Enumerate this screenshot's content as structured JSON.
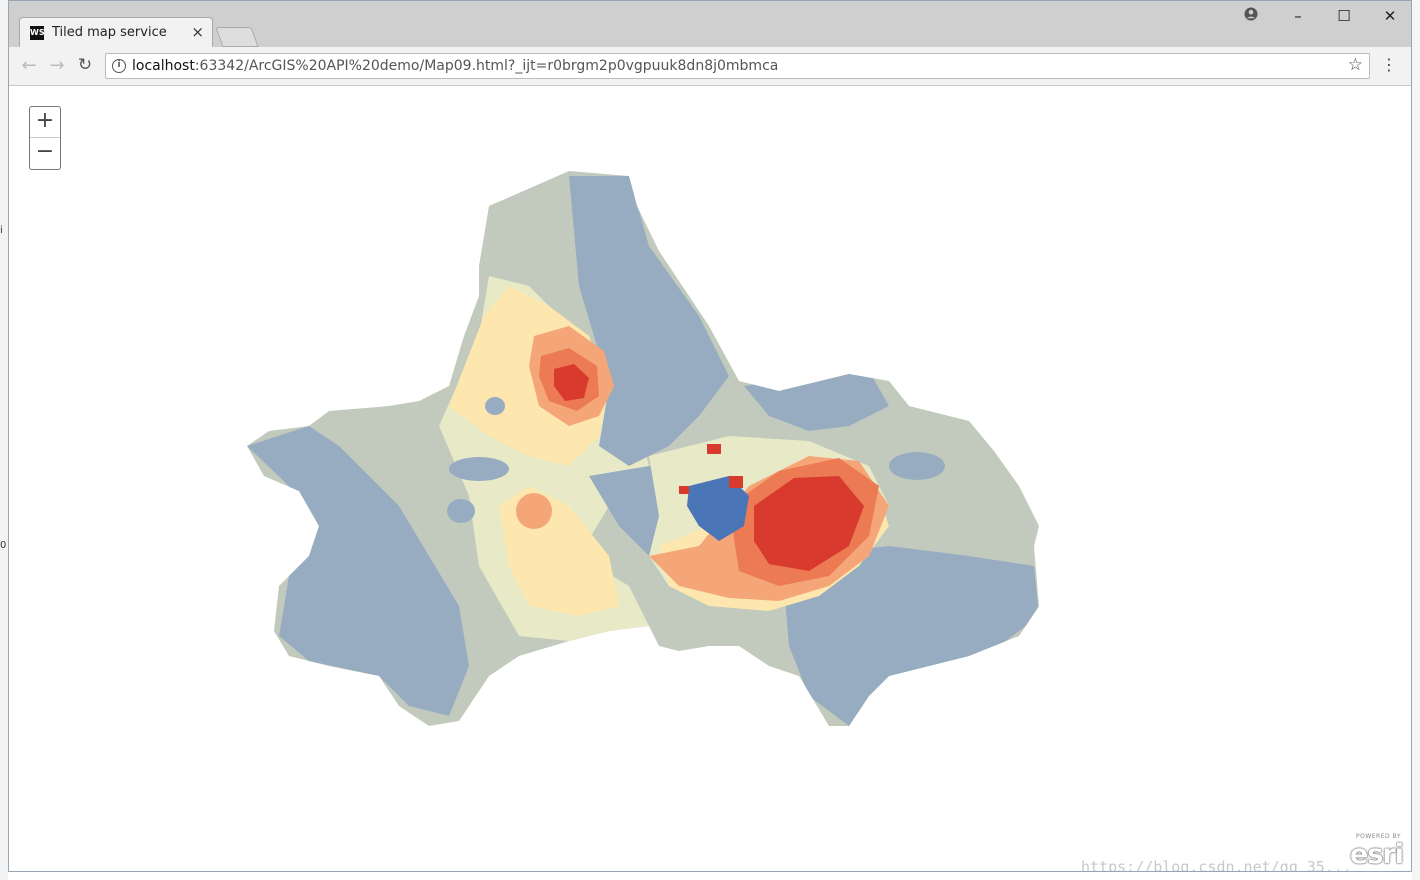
{
  "browser": {
    "tab": {
      "favicon_text": "WS",
      "title": "Tiled map service",
      "close_glyph": "×"
    },
    "window_controls": {
      "account": "account-icon",
      "minimize": "–",
      "maximize": "☐",
      "close": "✕"
    },
    "toolbar": {
      "back_icon": "←",
      "forward_icon": "→",
      "reload_icon": "↻",
      "url_host": "localhost",
      "url_rest": ":63342/ArcGIS%20API%20demo/Map09.html?_ijt=r0brgm2p0vgpuuk8dn8j0mbmca",
      "bookmark_star": "☆",
      "menu_dots": "⋮"
    }
  },
  "map": {
    "zoom_in": "+",
    "zoom_out": "−",
    "attribution": {
      "powered_by": "POWERED BY",
      "brand": "esri"
    },
    "palette": {
      "cool_dark": "#4a76b8",
      "cool": "#97acc0",
      "neutral": "#c1cabc",
      "light": "#e8e9c6",
      "pale": "#fde7ae",
      "warm": "#f4a679",
      "warm_mid": "#ec7a53",
      "hot": "#d93a2e"
    }
  },
  "watermark": "https://blog.csdn.net/qq_35..."
}
